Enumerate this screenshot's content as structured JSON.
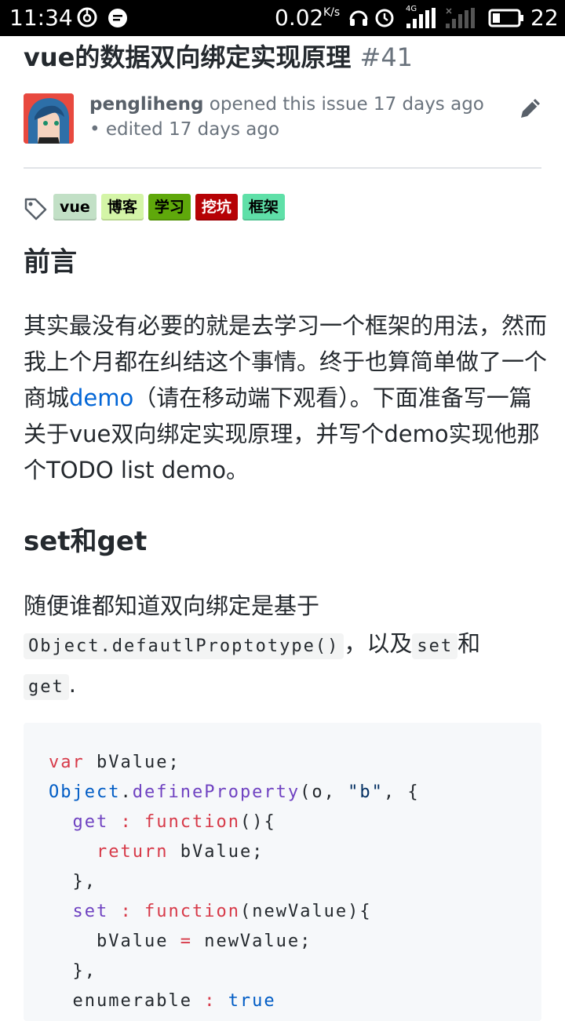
{
  "status_bar": {
    "time": "11:34",
    "net_speed": "0.02",
    "net_speed_unit": "K/s",
    "network_type": "4G",
    "battery": "22",
    "icons": [
      "netease-music-icon",
      "message-icon",
      "headphone-icon",
      "alarm-icon",
      "signal-icon",
      "signal-empty-icon",
      "battery-icon"
    ]
  },
  "issue": {
    "title": "vue的数据双向绑定实现原理",
    "number": "#41",
    "author": "pengliheng",
    "opened_text": " opened this issue 17 days ago • edited 17 days ago",
    "labels": [
      {
        "name": "vue",
        "bg": "#c2e0c6",
        "fg": "#000000"
      },
      {
        "name": "博客",
        "bg": "#d4f5a7",
        "fg": "#000000"
      },
      {
        "name": "学习",
        "bg": "#5fa80b",
        "fg": "#000000"
      },
      {
        "name": "挖坑",
        "bg": "#b60205",
        "fg": "#ffffff"
      },
      {
        "name": "框架",
        "bg": "#5fe0a8",
        "fg": "#000000"
      }
    ]
  },
  "body": {
    "heading1": "前言",
    "para1_before": "其实最没有必要的就是去学习一个框架的用法，然而我上个月都在纠结这个事情。终于也算简单做了一个商城",
    "para1_link": "demo",
    "para1_after": "（请在移动端下观看）。下面准备写一篇关于vue双向绑定实现原理，并写个demo实现他那个TODO list demo。",
    "heading2": "set和get",
    "para2_a": "随便谁都知道双向绑定是基于",
    "code_inline_1": "Object.defautlProptotype()",
    "para2_b": "，以及",
    "code_inline_2": "set",
    "para2_c": "和",
    "code_inline_3": "get",
    "para2_d": ".",
    "code_lines": [
      "var bValue;",
      "Object.defineProperty(o, \"b\", {",
      "  get : function(){",
      "    return bValue;",
      "  },",
      "  set : function(newValue){",
      "    bValue = newValue;",
      "  },",
      "  enumerable : true"
    ]
  }
}
